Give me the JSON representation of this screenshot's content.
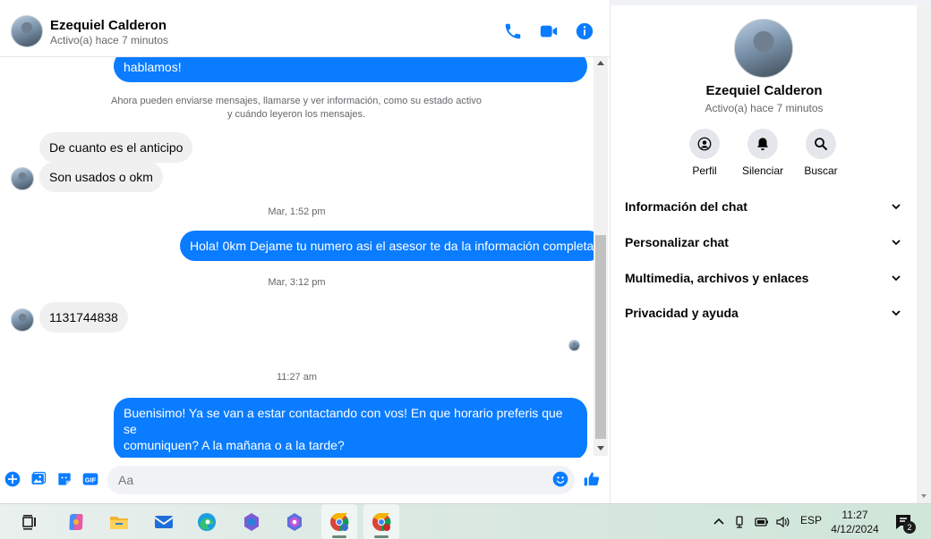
{
  "contact": {
    "name": "Ezequiel Calderon",
    "status": "Activo(a) hace 7 minutos"
  },
  "colors": {
    "accent": "#0a7cff",
    "incoming": "#f0f0f0",
    "muted": "#65676b"
  },
  "header": {
    "icons": [
      "phone-icon",
      "video-call-icon",
      "info-icon"
    ]
  },
  "messages": {
    "m0": "hablamos!",
    "system_line1": "Ahora pueden enviarse mensajes, llamarse y ver información, como su estado activo",
    "system_line2": "y cuándo leyeron los mensajes.",
    "m1": "De cuanto es el anticipo",
    "m2": "Son usados o okm",
    "ts1": "Mar, 1:52 pm",
    "m3": "Hola! 0km Dejame tu numero asi el asesor te da la información completa",
    "ts2": "Mar, 3:12 pm",
    "m4": "1131744838",
    "ts3": "11:27 am",
    "m5_line1": "Buenisimo! Ya se van a estar contactando con vos! En que horario preferis que se",
    "m5_line2": "comuniquen? A la mañana o a la tarde?"
  },
  "composer": {
    "placeholder": "Aa",
    "icons": [
      "add-icon",
      "image-icon",
      "sticker-icon",
      "gif-icon",
      "emoji-icon",
      "thumbs-up-icon"
    ]
  },
  "side": {
    "actions": [
      {
        "label": "Perfil",
        "icon": "profile-icon"
      },
      {
        "label": "Silenciar",
        "icon": "bell-icon"
      },
      {
        "label": "Buscar",
        "icon": "search-icon"
      }
    ],
    "sections": [
      "Información del chat",
      "Personalizar chat",
      "Multimedia, archivos y enlaces",
      "Privacidad y ayuda"
    ]
  },
  "taskbar": {
    "apps": [
      "task-view-icon",
      "copilot-icon",
      "file-explorer-icon",
      "mail-icon",
      "edge-icon",
      "m365-icon",
      "m365-copilot-icon",
      "chrome-profile-icon",
      "chrome-b-icon"
    ],
    "language": "ESP",
    "time": "11:27",
    "date": "4/12/2024",
    "notifications": "2"
  }
}
